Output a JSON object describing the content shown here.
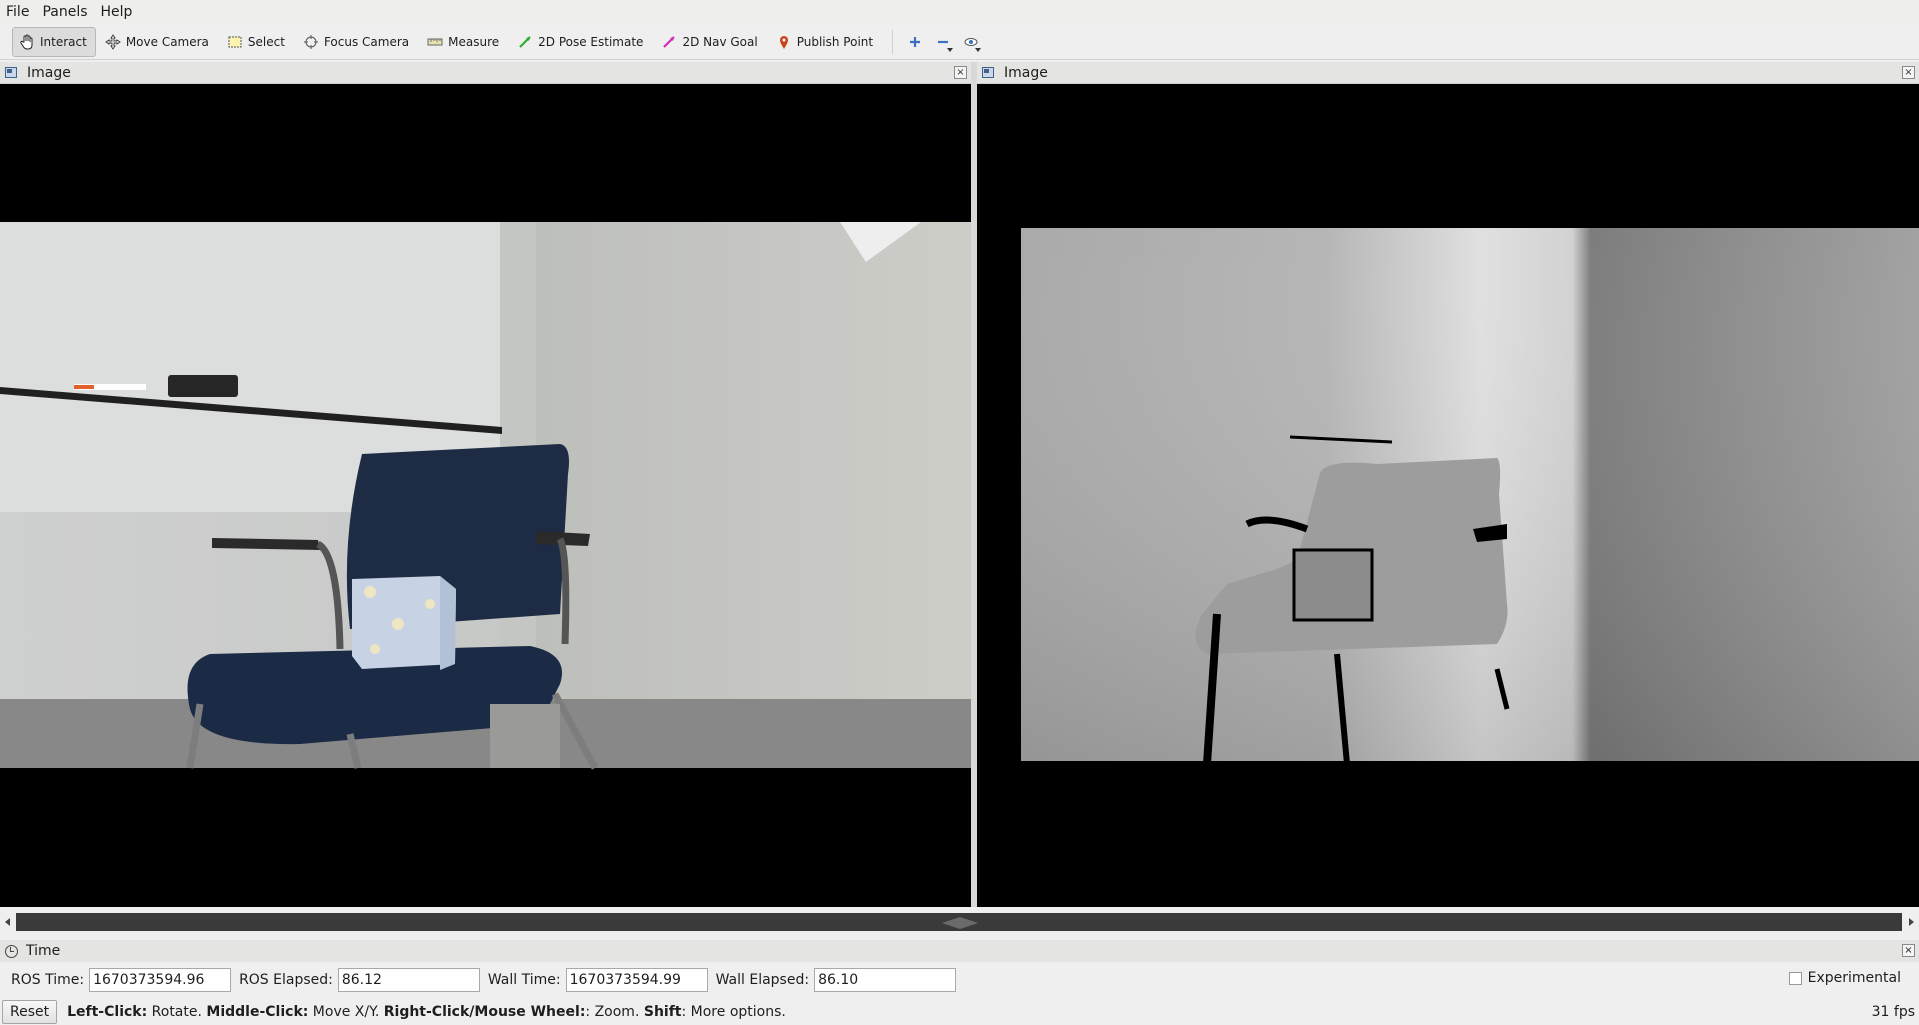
{
  "menu": {
    "items": [
      "File",
      "Panels",
      "Help"
    ]
  },
  "toolbar": {
    "tools": [
      {
        "label": "Interact",
        "icon": "hand-icon"
      },
      {
        "label": "Move Camera",
        "icon": "move-camera-icon"
      },
      {
        "label": "Select",
        "icon": "select-icon"
      },
      {
        "label": "Focus Camera",
        "icon": "focus-camera-icon"
      },
      {
        "label": "Measure",
        "icon": "measure-icon"
      },
      {
        "label": "2D Pose Estimate",
        "icon": "pose-estimate-icon"
      },
      {
        "label": "2D Nav Goal",
        "icon": "nav-goal-icon"
      },
      {
        "label": "Publish Point",
        "icon": "publish-point-icon"
      }
    ]
  },
  "panels": {
    "left": {
      "title": "Image"
    },
    "right": {
      "title": "Image"
    }
  },
  "time_panel": {
    "title": "Time",
    "ros_time_label": "ROS Time:",
    "ros_time": "1670373594.96",
    "ros_elapsed_label": "ROS Elapsed:",
    "ros_elapsed": "86.12",
    "wall_time_label": "Wall Time:",
    "wall_time": "1670373594.99",
    "wall_elapsed_label": "Wall Elapsed:",
    "wall_elapsed": "86.10",
    "experimental_label": "Experimental"
  },
  "status": {
    "reset_label": "Reset",
    "hint_1_bold": "Left-Click:",
    "hint_1": " Rotate. ",
    "hint_2_bold": "Middle-Click:",
    "hint_2": " Move X/Y. ",
    "hint_3_bold": "Right-Click/Mouse Wheel:",
    "hint_3": ": Zoom. ",
    "hint_4_bold": "Shift",
    "hint_4": ": More options.",
    "fps": "31 fps"
  }
}
